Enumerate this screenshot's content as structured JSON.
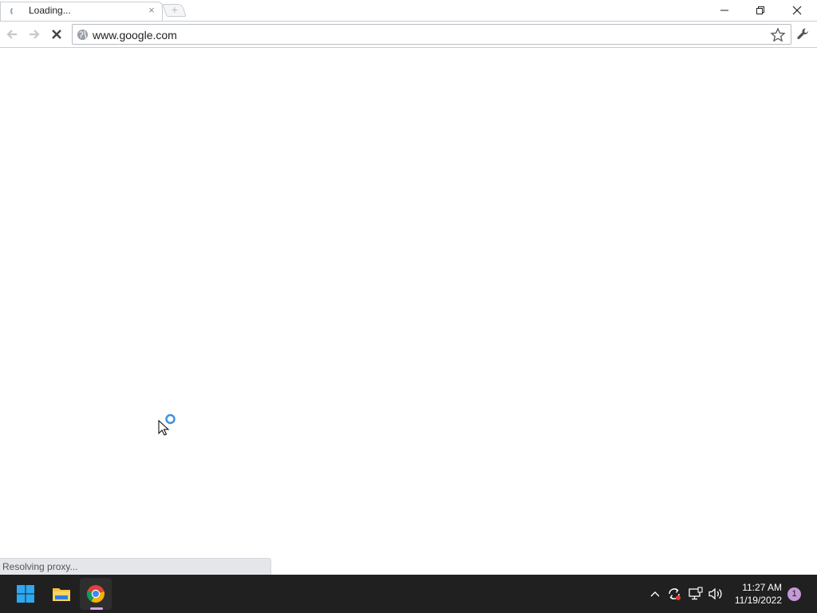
{
  "browser": {
    "tab": {
      "title": "Loading...",
      "close_label": "×",
      "new_tab_label": "+"
    },
    "window_controls": {
      "minimize_icon": "minimize-icon",
      "maximize_icon": "restore-icon",
      "close_icon": "close-icon"
    },
    "toolbar": {
      "back_icon": "back-arrow-icon",
      "forward_icon": "forward-arrow-icon",
      "stop_icon": "stop-icon",
      "url": "www.google.com",
      "page_icon": "globe-icon",
      "bookmark_icon": "star-icon",
      "settings_icon": "wrench-icon"
    },
    "status_text": "Resolving proxy..."
  },
  "taskbar": {
    "apps": [
      "windows-start-icon",
      "file-explorer-icon",
      "chrome-icon"
    ],
    "tray_icons": [
      "chevron-up-icon",
      "sync-icon",
      "network-icon",
      "volume-icon"
    ],
    "clock": {
      "time": "11:27 AM",
      "date": "11/19/2022"
    },
    "notification_count": "1",
    "accent_color": "#c39ad6"
  },
  "colors": {
    "taskbar_bg": "#202020",
    "windows_blue": "#2ea8f0",
    "cursor_busy": "#3b8fe0"
  }
}
